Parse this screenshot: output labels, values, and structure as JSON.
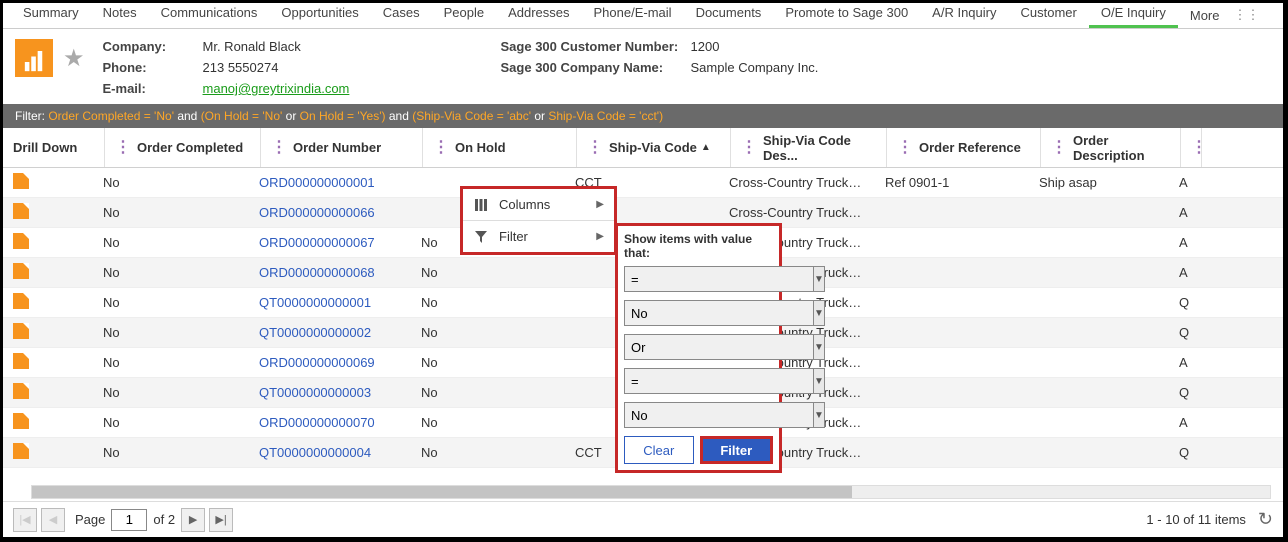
{
  "tabs": [
    "Summary",
    "Notes",
    "Communications",
    "Opportunities",
    "Cases",
    "People",
    "Addresses",
    "Phone/E-mail",
    "Documents",
    "Promote to Sage 300",
    "A/R Inquiry",
    "Customer",
    "O/E Inquiry"
  ],
  "active_tab": "O/E Inquiry",
  "more_label": "More",
  "info": {
    "company_label": "Company:",
    "company_value": "Mr. Ronald Black",
    "phone_label": "Phone:",
    "phone_value": "213 5550274",
    "email_label": "E-mail:",
    "email_value": "manoj@greytrixindia.com",
    "s300_num_label": "Sage 300 Customer Number:",
    "s300_num_value": "1200",
    "s300_name_label": "Sage 300 Company Name:",
    "s300_name_value": "Sample Company Inc."
  },
  "filter_bar": {
    "label": "Filter: ",
    "c1": "Order Completed = 'No'",
    "and1": " and ",
    "p1a": "(On Hold = 'No'",
    "or1": " or ",
    "p1b": "On Hold = 'Yes')",
    "and2": " and ",
    "p2a": "(Ship-Via Code = 'abc'",
    "or2": " or ",
    "p2b": "Ship-Via Code = 'cct')"
  },
  "columns": {
    "drill": "Drill Down",
    "completed": "Order Completed",
    "order": "Order Number",
    "hold": "On Hold",
    "ship": "Ship-Via Code",
    "shipdesc": "Ship-Via Code Des...",
    "ref": "Order Reference",
    "desc": "Order Description"
  },
  "col_menu": {
    "columns": "Columns",
    "filter": "Filter"
  },
  "filter_panel": {
    "title": "Show items with value that:",
    "op1": "=",
    "val1": "No",
    "logic": "Or",
    "op2": "=",
    "val2": "No",
    "clear": "Clear",
    "filter": "Filter"
  },
  "rows": [
    {
      "completed": "No",
      "order": "ORD000000000001",
      "hold": "",
      "ship": "CCT",
      "shipdesc": "Cross-Country Trucking ...",
      "ref": "Ref 0901-1",
      "desc": "Ship asap",
      "last": "A"
    },
    {
      "completed": "No",
      "order": "ORD000000000066",
      "hold": "",
      "ship": "",
      "shipdesc": "Cross-Country Trucking ...",
      "ref": "",
      "desc": "",
      "last": "A"
    },
    {
      "completed": "No",
      "order": "ORD000000000067",
      "hold": "No",
      "ship": "",
      "shipdesc": "Cross-Country Trucking ...",
      "ref": "",
      "desc": "",
      "last": "A"
    },
    {
      "completed": "No",
      "order": "ORD000000000068",
      "hold": "No",
      "ship": "",
      "shipdesc": "Cross-Country Trucking ...",
      "ref": "",
      "desc": "",
      "last": "A"
    },
    {
      "completed": "No",
      "order": "QT0000000000001",
      "hold": "No",
      "ship": "",
      "shipdesc": "Cross-Country Trucking ...",
      "ref": "",
      "desc": "",
      "last": "Q"
    },
    {
      "completed": "No",
      "order": "QT0000000000002",
      "hold": "No",
      "ship": "",
      "shipdesc": "Cross-Country Trucking ...",
      "ref": "",
      "desc": "",
      "last": "Q"
    },
    {
      "completed": "No",
      "order": "ORD000000000069",
      "hold": "No",
      "ship": "",
      "shipdesc": "Cross-Country Trucking ...",
      "ref": "",
      "desc": "",
      "last": "A"
    },
    {
      "completed": "No",
      "order": "QT0000000000003",
      "hold": "No",
      "ship": "",
      "shipdesc": "Cross-Country Trucking ...",
      "ref": "",
      "desc": "",
      "last": "Q"
    },
    {
      "completed": "No",
      "order": "ORD000000000070",
      "hold": "No",
      "ship": "",
      "shipdesc": "Cross-Country Trucking ...",
      "ref": "",
      "desc": "",
      "last": "A"
    },
    {
      "completed": "No",
      "order": "QT0000000000004",
      "hold": "No",
      "ship": "CCT",
      "shipdesc": "Cross-Country Trucking ...",
      "ref": "",
      "desc": "",
      "last": "Q"
    }
  ],
  "pager": {
    "page_label": "Page",
    "page_value": "1",
    "of_label": "of 2",
    "range": "1 - 10 of 11 items"
  }
}
